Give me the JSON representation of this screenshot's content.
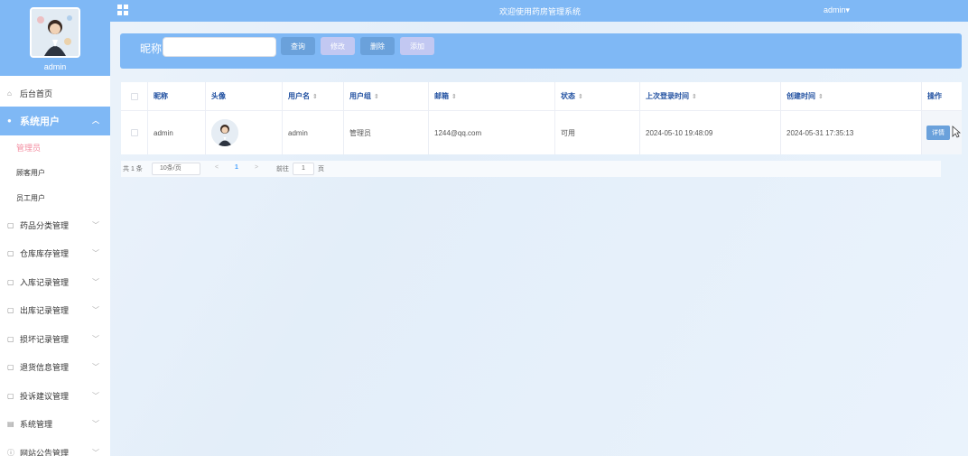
{
  "topbar": {
    "title": "欢迎使用药房管理系统",
    "user": "admin",
    "user_caret": "▾"
  },
  "sidebar": {
    "profile_name": "admin",
    "home": "后台首页",
    "system_users": {
      "label": "系统用户",
      "children": [
        "管理员",
        "顾客用户",
        "员工用户"
      ]
    },
    "items": [
      "药品分类管理",
      "仓库库存管理",
      "入库记录管理",
      "出库记录管理",
      "损坏记录管理",
      "退货信息管理",
      "投诉建议管理",
      "系统管理",
      "网站公告管理"
    ]
  },
  "search": {
    "label": "昵称",
    "placeholder": "",
    "buttons": {
      "query": "查询",
      "edit": "修改",
      "delete": "删除",
      "add": "添加"
    }
  },
  "table": {
    "headers": [
      "昵称",
      "头像",
      "用户名",
      "用户组",
      "邮箱",
      "状态",
      "上次登录时间",
      "创建时间",
      "操作"
    ],
    "rows": [
      {
        "nickname": "admin",
        "username": "admin",
        "group": "管理员",
        "email": "1244@qq.com",
        "status": "可用",
        "last_login": "2024-05-10 19:48:09",
        "created": "2024-05-31 17:35:13",
        "action": "详情"
      }
    ]
  },
  "pager": {
    "total": "共 1 条",
    "page_size": "10条/页",
    "prev": "<",
    "current": "1",
    "next": ">",
    "goto": "前往",
    "goto_value": "1",
    "page_unit": "页"
  },
  "colors": {
    "accent": "#7fb8f5",
    "button": "#6aa1db",
    "button_disabled": "#c2c8f2",
    "selected_sub": "#f38ea1"
  }
}
